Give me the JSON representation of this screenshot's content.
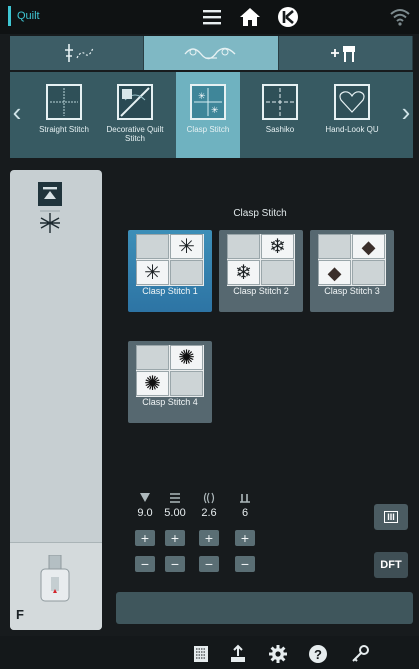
{
  "topbar": {
    "mode_label": "Quilt",
    "icons": [
      "menu-icon",
      "home-icon",
      "jump-to-start-icon",
      "wifi-icon"
    ]
  },
  "category_tabs": [
    {
      "icon": "needle-stitch-icon",
      "active": false
    },
    {
      "icon": "decorative-motif-icon",
      "active": true
    },
    {
      "icon": "add-stitch-icon",
      "active": false
    }
  ],
  "carousel": {
    "items": [
      {
        "label": "Straight Stitch",
        "active": false
      },
      {
        "label": "Decorative Quilt Stitch",
        "active": false
      },
      {
        "label": "Clasp Stitch",
        "active": true
      },
      {
        "label": "Sashiko",
        "active": false
      },
      {
        "label": "Hand-Look QU",
        "active": false
      }
    ]
  },
  "left_panel": {
    "selected_icon": "stitch-top-align-icon",
    "selected_stitch": "asterisk-stitch-icon",
    "presser_foot_letter": "F"
  },
  "main": {
    "category_title": "Clasp Stitch",
    "stitches": [
      {
        "label": "Clasp Stitch 1",
        "symbol": "✳",
        "active": true
      },
      {
        "label": "Clasp Stitch 2",
        "symbol": "❄",
        "active": false
      },
      {
        "label": "Clasp Stitch 3",
        "symbol": "◆",
        "active": false
      },
      {
        "label": "Clasp Stitch 4",
        "symbol": "✺",
        "active": false
      }
    ]
  },
  "params": [
    {
      "icon": "stitch-width-icon",
      "value": "9.0"
    },
    {
      "icon": "stitch-length-icon",
      "value": "5.00"
    },
    {
      "icon": "density-icon",
      "value": "2.6"
    },
    {
      "icon": "repeat-count-icon",
      "value": "6"
    }
  ],
  "right_buttons": {
    "option_label": "III",
    "dft_label": "DFT"
  },
  "bottombar": {
    "icons": [
      "stitch-program-icon",
      "export-icon",
      "settings-icon",
      "help-icon",
      "key-icon"
    ]
  },
  "colors": {
    "accent": "#3fc6d3",
    "active_card": "#2d74a4",
    "panel": "#375a62"
  }
}
